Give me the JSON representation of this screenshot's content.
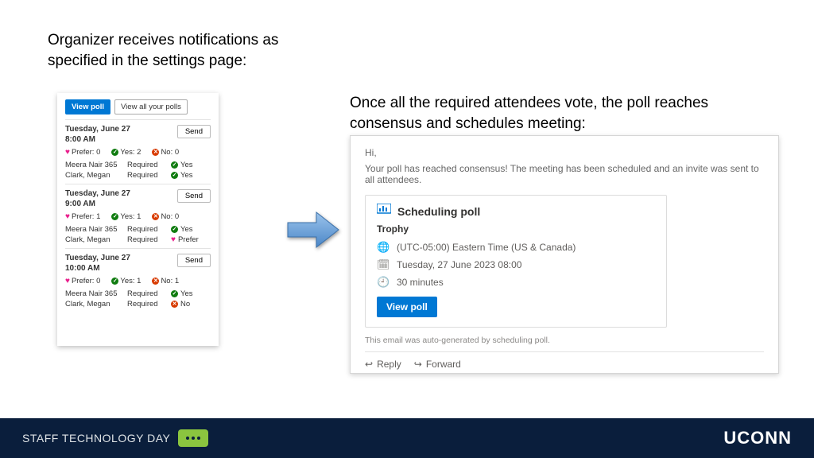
{
  "heading1": "Organizer receives notifications as specified in the settings page:",
  "heading2": "Once all the required attendees vote, the poll reaches consensus and schedules meeting:",
  "left": {
    "viewPoll": "View poll",
    "viewAll": "View all your polls",
    "send": "Send",
    "preferLbl": "Prefer:",
    "yesLbl": "Yes:",
    "noLbl": "No:",
    "slots": [
      {
        "date": "Tuesday, June 27",
        "time": "8:00 AM",
        "prefer": 0,
        "yes": 2,
        "no": 0,
        "rows": [
          {
            "name": "Meera Nair 365",
            "req": "Required",
            "vote": "Yes",
            "kind": "yes"
          },
          {
            "name": "Clark, Megan",
            "req": "Required",
            "vote": "Yes",
            "kind": "yes"
          }
        ]
      },
      {
        "date": "Tuesday, June 27",
        "time": "9:00 AM",
        "prefer": 1,
        "yes": 1,
        "no": 0,
        "rows": [
          {
            "name": "Meera Nair 365",
            "req": "Required",
            "vote": "Yes",
            "kind": "yes"
          },
          {
            "name": "Clark, Megan",
            "req": "Required",
            "vote": "Prefer",
            "kind": "prefer"
          }
        ]
      },
      {
        "date": "Tuesday, June 27",
        "time": "10:00 AM",
        "prefer": 0,
        "yes": 1,
        "no": 1,
        "rows": [
          {
            "name": "Meera Nair 365",
            "req": "Required",
            "vote": "Yes",
            "kind": "yes"
          },
          {
            "name": "Clark, Megan",
            "req": "Required",
            "vote": "No",
            "kind": "no"
          }
        ]
      }
    ]
  },
  "right": {
    "hi": "Hi,",
    "msg": "Your poll has reached consensus! The meeting has been scheduled and an invite was sent to all attendees.",
    "title": "Scheduling poll",
    "subject": "Trophy",
    "tz": "(UTC-05:00) Eastern Time (US & Canada)",
    "when": "Tuesday, 27 June 2023 08:00",
    "dur": "30 minutes",
    "viewPoll": "View poll",
    "auto": "This email was auto-generated by scheduling poll.",
    "reply": "Reply",
    "forward": "Forward"
  },
  "footer": {
    "title": "STAFF TECHNOLOGY DAY",
    "brand": "UCONN"
  }
}
